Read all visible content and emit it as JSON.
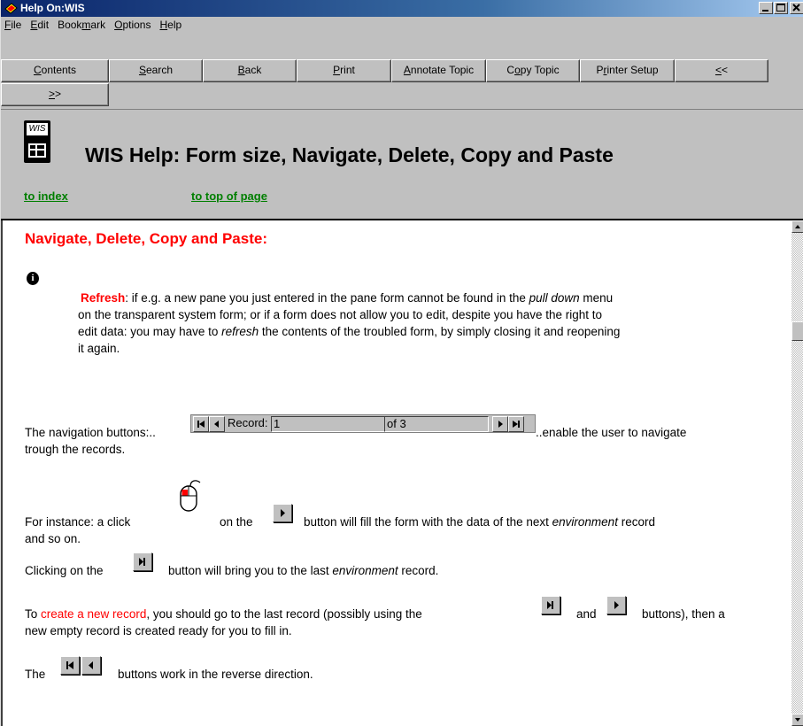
{
  "window": {
    "title": "Help On:WIS",
    "colors": {
      "titlebar": "#0a246a",
      "link": "#007f00",
      "heading": "#ff0000",
      "face": "#c0c0c0"
    }
  },
  "menu": [
    {
      "label": "File",
      "u": "F",
      "rest": "ile"
    },
    {
      "label": "Edit",
      "u": "E",
      "rest": "dit"
    },
    {
      "label": "Bookmark",
      "pre": "Book",
      "u": "m",
      "rest": "ark"
    },
    {
      "label": "Options",
      "u": "O",
      "rest": "ptions"
    },
    {
      "label": "Help",
      "u": "H",
      "rest": "elp"
    }
  ],
  "buttons": {
    "contents": {
      "u": "C",
      "rest": "ontents"
    },
    "search": {
      "u": "S",
      "rest": "earch"
    },
    "back": {
      "u": "B",
      "rest": "ack"
    },
    "print": {
      "u": "P",
      "rest": "rint"
    },
    "annotate": {
      "u": "A",
      "rest": "nnotate Topic"
    },
    "copy": {
      "pre": "C",
      "u": "o",
      "rest": "py Topic"
    },
    "printer_setup": {
      "pre": "P",
      "u": "r",
      "rest": "inter Setup"
    },
    "prev": {
      "u": "<",
      "rest": "<"
    },
    "next": {
      "u": ">",
      "rest": ">"
    }
  },
  "header": {
    "logo_text": "WIS",
    "title": "WIS Help: Form size, Navigate, Delete, Copy and Paste",
    "link_index": "to index",
    "link_top": "to top of page"
  },
  "content": {
    "section_title": "Navigate, Delete, Copy and Paste:",
    "info_icon": "i",
    "refresh": {
      "keyword": "Refresh",
      "p1": ": if e.g. a new pane you just entered in the pane form cannot be found in the ",
      "em1": "pull down",
      "p2": " menu",
      "line2": "on the transparent system form; or if a form does not allow you to edit, despite you have the right to",
      "line3a": "edit data: you may have to ",
      "em2": "refresh",
      "line3b": " the contents of the troubled form, by simply closing it and reopening",
      "line4": "it again."
    },
    "navigation": {
      "before": "The navigation buttons:..",
      "after": "..enable the user to navigate",
      "line2": "trough the records.",
      "record_label": "Record:",
      "record_value": "1",
      "of_label": "of 3"
    },
    "instance": {
      "a": "For instance: a click",
      "b": "on the",
      "c": "button will fill the form with the data of the next ",
      "em": "environment",
      "d": " record",
      "line2": "and so on."
    },
    "clicking": {
      "a": "Clicking on the",
      "b": "button will bring you to the last ",
      "em": "environment",
      "c": " record."
    },
    "create": {
      "a": "To ",
      "link": "create a new record",
      "b": ", you should go to the last record (possibly using the",
      "c": "and",
      "d": "buttons), then a",
      "line2": "new empty record is created ready for you to fill in."
    },
    "reverse": {
      "a": "The",
      "b": "buttons work in the reverse direction."
    },
    "nav_glyphs": {
      "first": "H◀",
      "prev": "◀",
      "next": "▶",
      "last": "▶H"
    }
  }
}
